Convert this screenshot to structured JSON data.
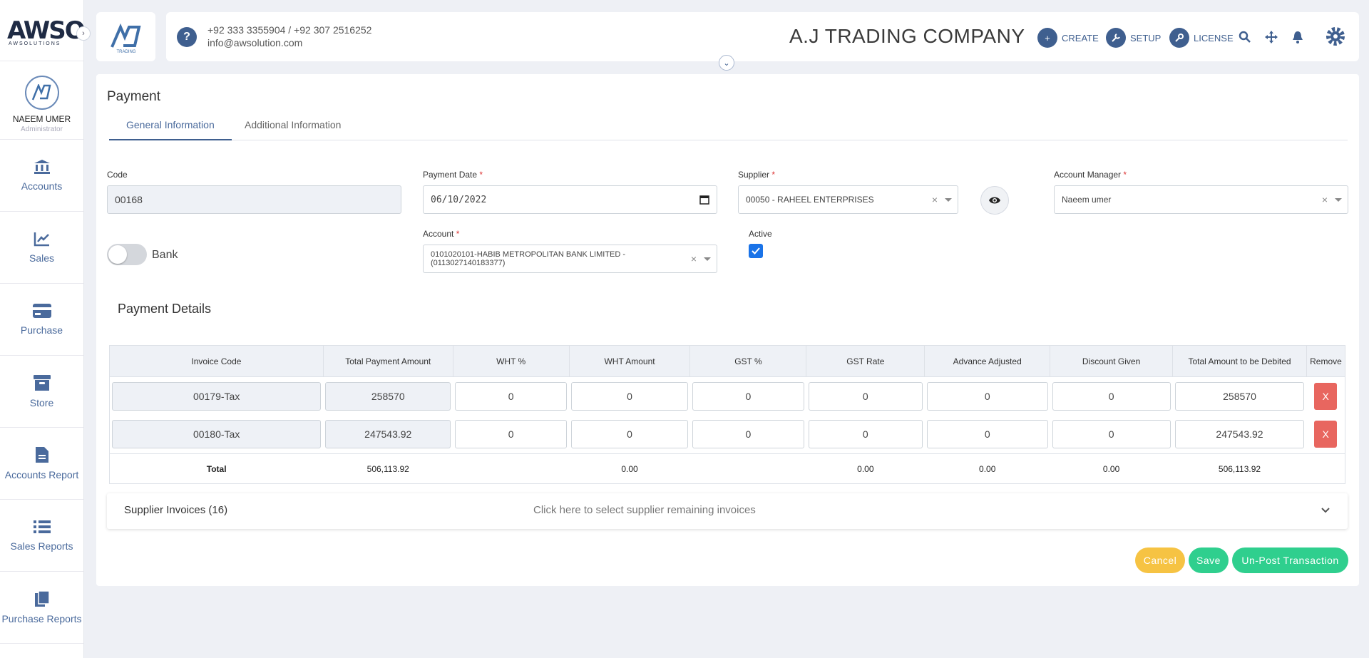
{
  "sidebar": {
    "logo_text": "AWSO",
    "logo_sub": "AWSOLUTIONS",
    "profile": {
      "name": "NAEEM UMER",
      "role": "Administrator"
    },
    "items": [
      {
        "label": "Accounts",
        "icon": "bank-icon"
      },
      {
        "label": "Sales",
        "icon": "chart-line-icon"
      },
      {
        "label": "Purchase",
        "icon": "credit-card-icon"
      },
      {
        "label": "Store",
        "icon": "archive-box-icon"
      },
      {
        "label": "Accounts Report",
        "icon": "file-icon"
      },
      {
        "label": "Sales Reports",
        "icon": "list-icon"
      },
      {
        "label": "Purchase Reports",
        "icon": "clipboard-icon"
      }
    ]
  },
  "header": {
    "brand_sub": "TRADING",
    "phones": "+92 333 3355904 / +92 307 2516252",
    "email": "info@awsolution.com",
    "company": "A.J TRADING COMPANY",
    "actions": {
      "create": "CREATE",
      "setup": "SETUP",
      "license": "LICENSE"
    }
  },
  "page": {
    "title": "Payment",
    "tabs": [
      "General Information",
      "Additional Information"
    ]
  },
  "form": {
    "code": {
      "label": "Code",
      "value": "00168"
    },
    "payment_date": {
      "label": "Payment Date",
      "value": "06/10/2022"
    },
    "supplier": {
      "label": "Supplier",
      "value": "00050 - RAHEEL ENTERPRISES"
    },
    "account_manager": {
      "label": "Account Manager",
      "value": "Naeem umer"
    },
    "bank": {
      "label": "Bank"
    },
    "account": {
      "label": "Account",
      "value_line1": "0101020101-HABIB METROPOLITAN BANK LIMITED -",
      "value_line2": "(0113027140183377)"
    },
    "active": {
      "label": "Active",
      "checked": true
    },
    "required_marker": "*"
  },
  "details": {
    "title": "Payment Details",
    "columns": [
      "Invoice Code",
      "Total Payment Amount",
      "WHT %",
      "WHT Amount",
      "GST %",
      "GST Rate",
      "Advance Adjusted",
      "Discount Given",
      "Total Amount to be Debited",
      "Remove"
    ],
    "rows": [
      {
        "invoice": "00179-Tax",
        "total_payment": "258570",
        "wht_pct": "0",
        "wht_amt": "0",
        "gst_pct": "0",
        "gst_rate": "0",
        "advance": "0",
        "discount": "0",
        "debited": "258570",
        "remove": "X"
      },
      {
        "invoice": "00180-Tax",
        "total_payment": "247543.92",
        "wht_pct": "0",
        "wht_amt": "0",
        "gst_pct": "0",
        "gst_rate": "0",
        "advance": "0",
        "discount": "0",
        "debited": "247543.92",
        "remove": "X"
      }
    ],
    "totals": {
      "label": "Total",
      "total_payment": "506,113.92",
      "wht_amt": "0.00",
      "gst_rate": "0.00",
      "advance": "0.00",
      "discount": "0.00",
      "debited": "506,113.92"
    }
  },
  "supplier_invoices": {
    "title": "Supplier Invoices (16)",
    "hint": "Click here to select supplier remaining invoices"
  },
  "buttons": {
    "cancel": "Cancel",
    "save": "Save",
    "unpost": "Un-Post Transaction"
  },
  "colors": {
    "primary": "#3f5f8f",
    "cancel": "#f6c343",
    "save": "#2fcf8e",
    "remove": "#e8665f"
  }
}
